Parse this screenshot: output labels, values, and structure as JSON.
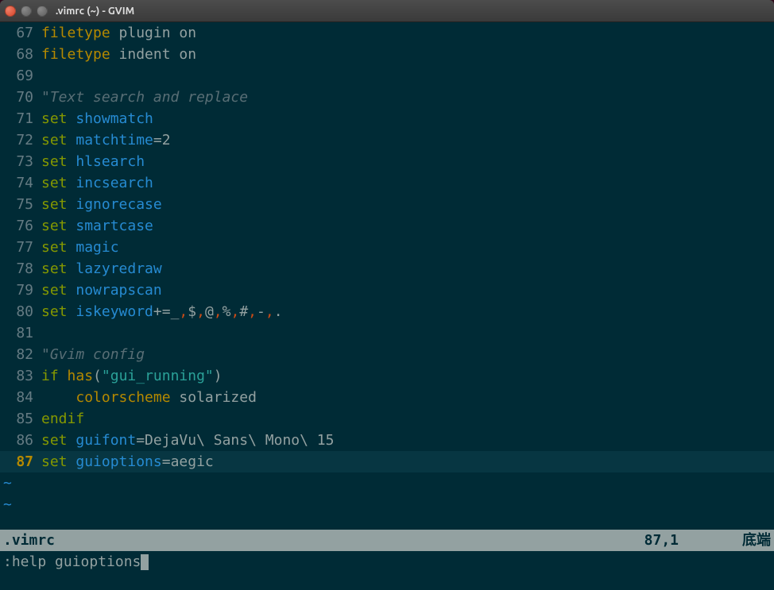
{
  "titlebar": {
    "title": ".vimrc (~) - GVIM"
  },
  "lines": [
    {
      "n": 67,
      "tokens": [
        {
          "c": "type",
          "t": "filetype"
        },
        {
          "c": "plain",
          "t": " plugin on"
        }
      ]
    },
    {
      "n": 68,
      "tokens": [
        {
          "c": "type",
          "t": "filetype"
        },
        {
          "c": "plain",
          "t": " indent on"
        }
      ]
    },
    {
      "n": 69,
      "tokens": []
    },
    {
      "n": 70,
      "tokens": [
        {
          "c": "cmt",
          "t": "\"Text search and replace"
        }
      ]
    },
    {
      "n": 71,
      "tokens": [
        {
          "c": "kw",
          "t": "set"
        },
        {
          "c": "plain",
          "t": " "
        },
        {
          "c": "opt",
          "t": "showmatch"
        }
      ]
    },
    {
      "n": 72,
      "tokens": [
        {
          "c": "kw",
          "t": "set"
        },
        {
          "c": "plain",
          "t": " "
        },
        {
          "c": "opt",
          "t": "matchtime"
        },
        {
          "c": "plain",
          "t": "=2"
        }
      ]
    },
    {
      "n": 73,
      "tokens": [
        {
          "c": "kw",
          "t": "set"
        },
        {
          "c": "plain",
          "t": " "
        },
        {
          "c": "opt",
          "t": "hlsearch"
        }
      ]
    },
    {
      "n": 74,
      "tokens": [
        {
          "c": "kw",
          "t": "set"
        },
        {
          "c": "plain",
          "t": " "
        },
        {
          "c": "opt",
          "t": "incsearch"
        }
      ]
    },
    {
      "n": 75,
      "tokens": [
        {
          "c": "kw",
          "t": "set"
        },
        {
          "c": "plain",
          "t": " "
        },
        {
          "c": "opt",
          "t": "ignorecase"
        }
      ]
    },
    {
      "n": 76,
      "tokens": [
        {
          "c": "kw",
          "t": "set"
        },
        {
          "c": "plain",
          "t": " "
        },
        {
          "c": "opt",
          "t": "smartcase"
        }
      ]
    },
    {
      "n": 77,
      "tokens": [
        {
          "c": "kw",
          "t": "set"
        },
        {
          "c": "plain",
          "t": " "
        },
        {
          "c": "opt",
          "t": "magic"
        }
      ]
    },
    {
      "n": 78,
      "tokens": [
        {
          "c": "kw",
          "t": "set"
        },
        {
          "c": "plain",
          "t": " "
        },
        {
          "c": "opt",
          "t": "lazyredraw"
        }
      ]
    },
    {
      "n": 79,
      "tokens": [
        {
          "c": "kw",
          "t": "set"
        },
        {
          "c": "plain",
          "t": " "
        },
        {
          "c": "opt",
          "t": "nowrapscan"
        }
      ]
    },
    {
      "n": 80,
      "tokens": [
        {
          "c": "kw",
          "t": "set"
        },
        {
          "c": "plain",
          "t": " "
        },
        {
          "c": "opt",
          "t": "iskeyword"
        },
        {
          "c": "plain",
          "t": "+=_"
        },
        {
          "c": "sym",
          "t": ","
        },
        {
          "c": "plain",
          "t": "$"
        },
        {
          "c": "sym",
          "t": ","
        },
        {
          "c": "plain",
          "t": "@"
        },
        {
          "c": "sym",
          "t": ","
        },
        {
          "c": "plain",
          "t": "%"
        },
        {
          "c": "sym",
          "t": ","
        },
        {
          "c": "plain",
          "t": "#"
        },
        {
          "c": "sym",
          "t": ","
        },
        {
          "c": "plain",
          "t": "-"
        },
        {
          "c": "sym",
          "t": ","
        },
        {
          "c": "plain",
          "t": "."
        }
      ]
    },
    {
      "n": 81,
      "tokens": []
    },
    {
      "n": 82,
      "tokens": [
        {
          "c": "cmt",
          "t": "\"Gvim config"
        }
      ]
    },
    {
      "n": 83,
      "tokens": [
        {
          "c": "kw",
          "t": "if"
        },
        {
          "c": "plain",
          "t": " "
        },
        {
          "c": "type",
          "t": "has"
        },
        {
          "c": "plain",
          "t": "("
        },
        {
          "c": "str",
          "t": "\"gui_running\""
        },
        {
          "c": "plain",
          "t": ")"
        }
      ]
    },
    {
      "n": 84,
      "tokens": [
        {
          "c": "plain",
          "t": "    "
        },
        {
          "c": "type",
          "t": "colorscheme"
        },
        {
          "c": "plain",
          "t": " solarized"
        }
      ]
    },
    {
      "n": 85,
      "tokens": [
        {
          "c": "kw",
          "t": "endif"
        }
      ]
    },
    {
      "n": 86,
      "tokens": [
        {
          "c": "kw",
          "t": "set"
        },
        {
          "c": "plain",
          "t": " "
        },
        {
          "c": "opt",
          "t": "guifont"
        },
        {
          "c": "plain",
          "t": "=DejaVu\\ Sans\\ Mono\\ 15"
        }
      ]
    },
    {
      "n": 87,
      "current": true,
      "tokens": [
        {
          "c": "kw",
          "t": "set"
        },
        {
          "c": "plain",
          "t": " "
        },
        {
          "c": "opt",
          "t": "guioptions"
        },
        {
          "c": "plain",
          "t": "=aegic"
        }
      ]
    }
  ],
  "tilde_count": 2,
  "statusline": {
    "filename": ".vimrc",
    "position": "87,1",
    "location": "底端"
  },
  "cmdline": {
    "text": ":help guioptions"
  }
}
